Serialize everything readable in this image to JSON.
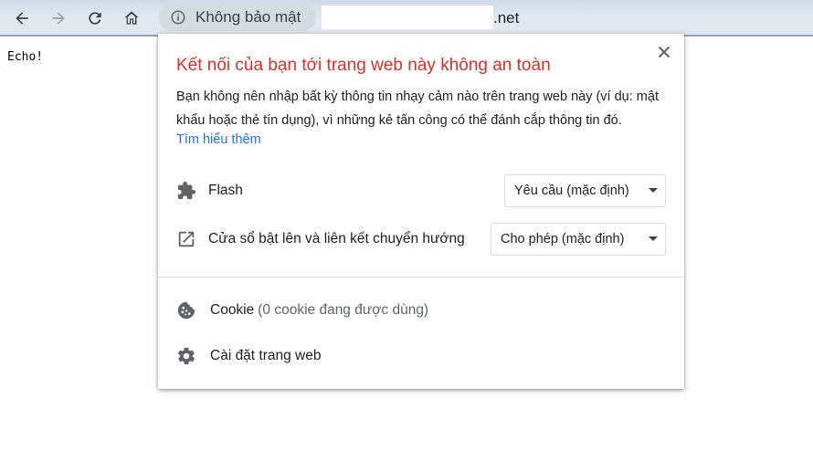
{
  "toolbar": {
    "security_chip_label": "Không bảo mật",
    "url_suffix": ".net"
  },
  "page": {
    "body_text": "Echo!"
  },
  "popup": {
    "title": "Kết nối của bạn tới trang web này không an toàn",
    "description": "Bạn không nên nhập bất kỳ thông tin nhạy cảm nào trên trang web này (ví dụ: mật khẩu hoặc thẻ tín dụng), vì những kẻ tấn công có thể đánh cắp thông tin đó.",
    "learn_more": "Tìm hiểu thêm",
    "permissions": [
      {
        "label": "Flash",
        "value": "Yêu cầu (mặc định)",
        "icon": "puzzle-icon"
      },
      {
        "label": "Cửa sổ bật lên và liên kết chuyển hướng",
        "value": "Cho phép (mặc định)",
        "icon": "open-in-new-icon"
      }
    ],
    "cookie_label": "Cookie",
    "cookie_detail": "(0 cookie đang được dùng)",
    "site_settings_label": "Cài đặt trang web"
  },
  "colors": {
    "title_red": "#d93025",
    "link_blue": "#1a73e8",
    "icon_gray": "#5f6368"
  }
}
